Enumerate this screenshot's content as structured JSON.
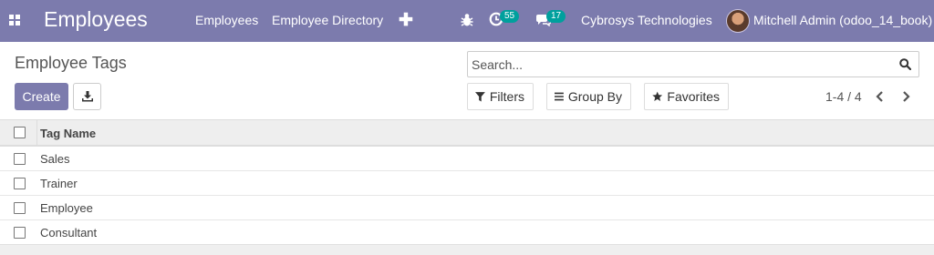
{
  "navbar": {
    "app_title": "Employees",
    "menu": [
      "Employees",
      "Employee Directory"
    ],
    "activity_count": "55",
    "message_count": "17",
    "company": "Cybrosys Technologies",
    "user": "Mitchell Admin (odoo_14_book)",
    "color": "#7c7bad"
  },
  "control_panel": {
    "breadcrumb": "Employee Tags",
    "create_label": "Create",
    "search_placeholder": "Search...",
    "filters_label": "Filters",
    "groupby_label": "Group By",
    "favorites_label": "Favorites",
    "pager": "1-4 / 4"
  },
  "list": {
    "header": "Tag Name",
    "rows": [
      "Sales",
      "Trainer",
      "Employee",
      "Consultant"
    ]
  }
}
